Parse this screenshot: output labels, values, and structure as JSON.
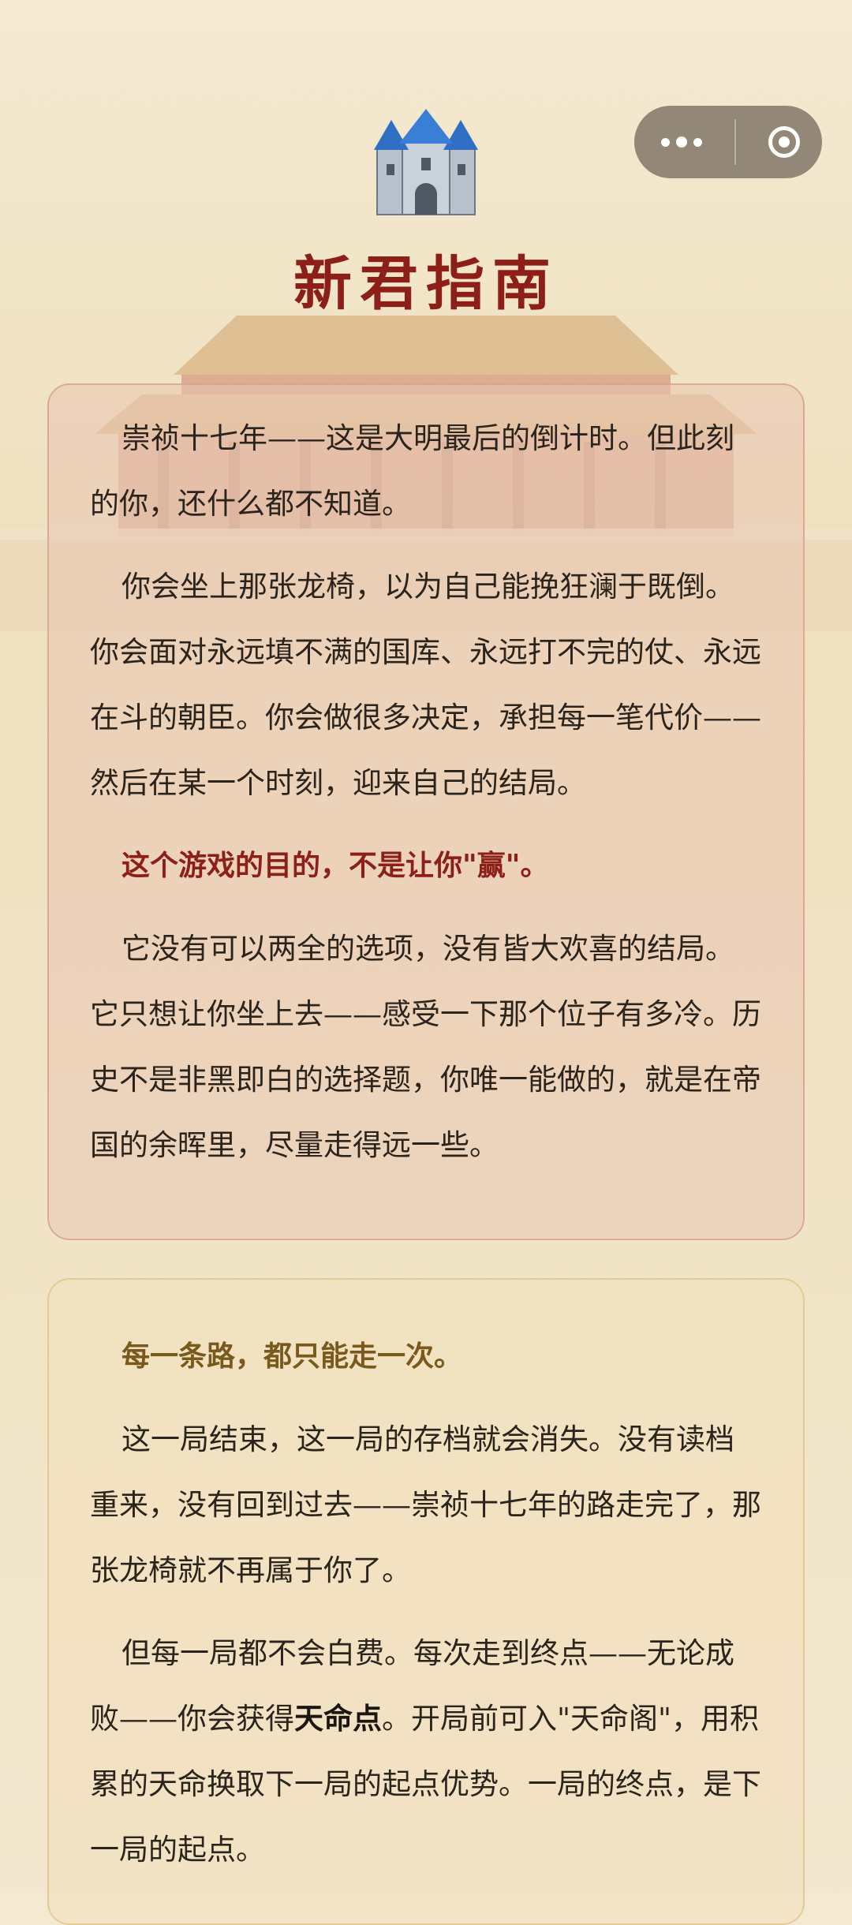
{
  "header": {
    "title": "新君指南"
  },
  "intro": {
    "para1": "崇祯十七年——这是大明最后的倒计时。但此刻的你，还什么都不知道。",
    "para2": "你会坐上那张龙椅，以为自己能挽狂澜于既倒。你会面对永远填不满的国库、永远打不完的仗、永远在斗的朝臣。你会做很多决定，承担每一笔代价——然后在某一个时刻，迎来自己的结局。",
    "highlight": "这个游戏的目的，不是让你\"赢\"。",
    "para3": "它没有可以两全的选项，没有皆大欢喜的结局。它只想让你坐上去——感受一下那个位子有多冷。历史不是非黑即白的选择题，你唯一能做的，就是在帝国的余晖里，尽量走得远一些。"
  },
  "rules": {
    "highlight": "每一条路，都只能走一次。",
    "para1": "这一局结束，这一局的存档就会消失。没有读档重来，没有回到过去——崇祯十七年的路走完了，那张龙椅就不再属于你了。",
    "para2_a": "但每一局都不会白费。每次走到终点——无论成败——你会获得",
    "para2_bold": "天命点",
    "para2_b": "。开局前可入\"天命阁\"，用积累的天命换取下一局的起点优势。一局的终点，是下一局的起点。"
  },
  "icons": {
    "logo": "castle-icon",
    "more": "more-dots-icon",
    "close": "target-close-icon"
  },
  "colors": {
    "title": "#8c1f18",
    "highlight_red": "#8c1f18",
    "highlight_gold": "#7a5a1c"
  }
}
